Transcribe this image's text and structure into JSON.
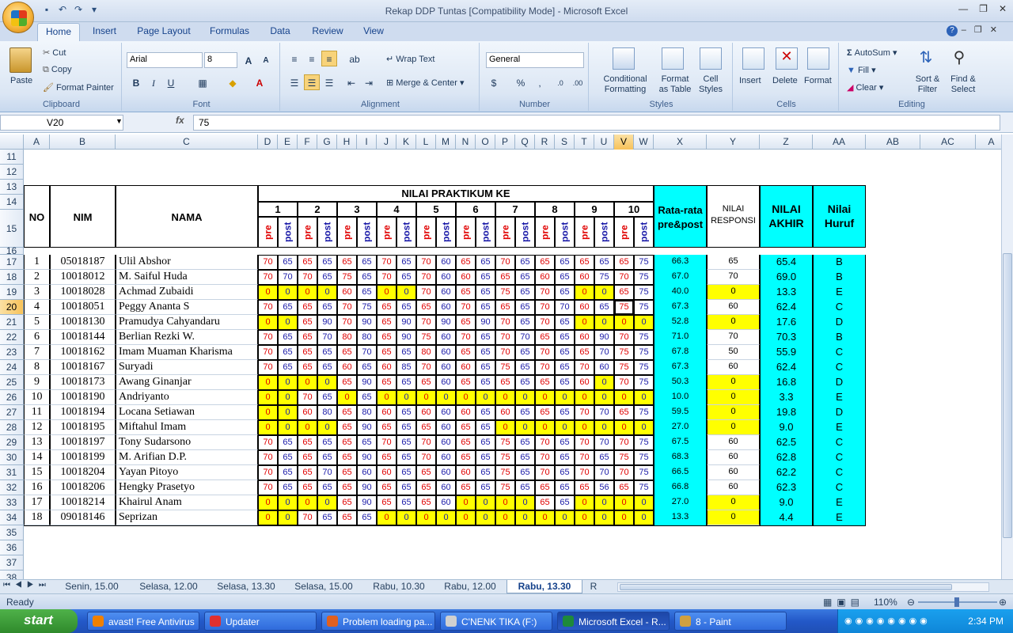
{
  "app": {
    "title": "Rekap DDP Tuntas  [Compatibility Mode] - Microsoft Excel"
  },
  "ribbon": {
    "tabs": [
      "Home",
      "Insert",
      "Page Layout",
      "Formulas",
      "Data",
      "Review",
      "View"
    ],
    "clipboard": {
      "paste": "Paste",
      "cut": "Cut",
      "copy": "Copy",
      "format_painter": "Format Painter",
      "label": "Clipboard"
    },
    "font": {
      "name": "Arial",
      "size": "8",
      "label": "Font"
    },
    "alignment": {
      "wrap": "Wrap Text",
      "merge": "Merge & Center",
      "label": "Alignment"
    },
    "number": {
      "format": "General",
      "label": "Number"
    },
    "styles": {
      "conditional": "Conditional Formatting",
      "format_table": "Format as Table",
      "cell_styles": "Cell Styles",
      "label": "Styles"
    },
    "cells": {
      "insert": "Insert",
      "delete": "Delete",
      "format": "Format",
      "label": "Cells"
    },
    "editing": {
      "autosum": "AutoSum",
      "fill": "Fill",
      "clear": "Clear",
      "sort": "Sort & Filter",
      "find": "Find & Select",
      "label": "Editing"
    }
  },
  "formula_bar": {
    "name_box": "V20",
    "fx": "fx",
    "value": "75"
  },
  "columns": [
    "A",
    "B",
    "C",
    "D",
    "E",
    "F",
    "G",
    "H",
    "I",
    "J",
    "K",
    "L",
    "M",
    "N",
    "O",
    "P",
    "Q",
    "R",
    "S",
    "T",
    "U",
    "V",
    "W",
    "X",
    "Y",
    "Z",
    "AA",
    "AB",
    "AC",
    "A"
  ],
  "header": {
    "no": "NO",
    "nim": "NIM",
    "nama": "NAMA",
    "praktikum": "NILAI PRAKTIKUM KE",
    "rata": "Rata-rata pre&post",
    "responsi": "NILAI RESPONSI",
    "akhir": "NILAI AKHIR",
    "huruf": "Nilai Huruf",
    "pre": "pre",
    "post": "post",
    "numbers": [
      "1",
      "2",
      "3",
      "4",
      "5",
      "6",
      "7",
      "8",
      "9",
      "10"
    ]
  },
  "students": [
    {
      "row": "17",
      "no": "1",
      "nim": "05018187",
      "nama": "Ulil Abshor",
      "scores": [
        "70",
        "65",
        "65",
        "65",
        "65",
        "65",
        "70",
        "65",
        "70",
        "60",
        "65",
        "65",
        "70",
        "65",
        "65",
        "65",
        "65",
        "65",
        "65",
        "75"
      ],
      "yel": 0,
      "rata": "66.3",
      "resp": "65",
      "akhir": "65.4",
      "huruf": "B"
    },
    {
      "row": "18",
      "no": "2",
      "nim": "10018012",
      "nama": "M. Saiful Huda",
      "scores": [
        "70",
        "70",
        "70",
        "65",
        "75",
        "65",
        "70",
        "65",
        "70",
        "60",
        "60",
        "65",
        "65",
        "65",
        "60",
        "65",
        "60",
        "75",
        "70",
        "75"
      ],
      "yel": 0,
      "rata": "67.0",
      "resp": "70",
      "akhir": "69.0",
      "huruf": "B"
    },
    {
      "row": "19",
      "no": "3",
      "nim": "10018028",
      "nama": "Achmad Zubaidi",
      "scores": [
        "0",
        "0",
        "0",
        "0",
        "60",
        "65",
        "0",
        "0",
        "70",
        "60",
        "65",
        "65",
        "75",
        "65",
        "70",
        "65",
        "0",
        "0",
        "65",
        "75"
      ],
      "yel": [
        0,
        1,
        2,
        3,
        6,
        7,
        16,
        17
      ],
      "rata": "40.0",
      "resp": "0",
      "akhir": "13.3",
      "huruf": "E"
    },
    {
      "row": "20",
      "no": "4",
      "nim": "10018051",
      "nama": "Peggy Ananta S",
      "scores": [
        "70",
        "65",
        "65",
        "65",
        "70",
        "75",
        "65",
        "65",
        "65",
        "60",
        "70",
        "65",
        "65",
        "65",
        "70",
        "70",
        "60",
        "65",
        "75",
        "75"
      ],
      "yel": 0,
      "rata": "67.3",
      "resp": "60",
      "akhir": "62.4",
      "huruf": "C"
    },
    {
      "row": "21",
      "no": "5",
      "nim": "10018130",
      "nama": "Pramudya Cahyandaru",
      "scores": [
        "0",
        "0",
        "65",
        "90",
        "70",
        "90",
        "65",
        "90",
        "70",
        "90",
        "65",
        "90",
        "70",
        "65",
        "70",
        "65",
        "0",
        "0",
        "0",
        "0"
      ],
      "yel": [
        0,
        1,
        16,
        17,
        18,
        19
      ],
      "rata": "52.8",
      "resp": "0",
      "akhir": "17.6",
      "huruf": "D"
    },
    {
      "row": "22",
      "no": "6",
      "nim": "10018144",
      "nama": "Berlian Rezki W.",
      "scores": [
        "70",
        "65",
        "65",
        "70",
        "80",
        "80",
        "65",
        "90",
        "75",
        "60",
        "70",
        "65",
        "70",
        "70",
        "65",
        "65",
        "60",
        "90",
        "70",
        "75"
      ],
      "yel": 0,
      "rata": "71.0",
      "resp": "70",
      "akhir": "70.3",
      "huruf": "B"
    },
    {
      "row": "23",
      "no": "7",
      "nim": "10018162",
      "nama": "Imam Muaman Kharisma",
      "scores": [
        "70",
        "65",
        "65",
        "65",
        "65",
        "70",
        "65",
        "65",
        "80",
        "60",
        "65",
        "65",
        "70",
        "65",
        "70",
        "65",
        "65",
        "70",
        "75",
        "75"
      ],
      "yel": 0,
      "rata": "67.8",
      "resp": "50",
      "akhir": "55.9",
      "huruf": "C"
    },
    {
      "row": "24",
      "no": "8",
      "nim": "10018167",
      "nama": "Suryadi",
      "scores": [
        "70",
        "65",
        "65",
        "65",
        "60",
        "65",
        "60",
        "85",
        "70",
        "60",
        "60",
        "65",
        "75",
        "65",
        "70",
        "65",
        "70",
        "60",
        "75",
        "75"
      ],
      "yel": 0,
      "rata": "67.3",
      "resp": "60",
      "akhir": "62.4",
      "huruf": "C"
    },
    {
      "row": "25",
      "no": "9",
      "nim": "10018173",
      "nama": "Awang Ginanjar",
      "scores": [
        "0",
        "0",
        "0",
        "0",
        "65",
        "90",
        "65",
        "65",
        "65",
        "60",
        "65",
        "65",
        "65",
        "65",
        "65",
        "65",
        "60",
        "0",
        "70",
        "75"
      ],
      "yel": [
        0,
        1,
        2,
        3,
        17
      ],
      "rata": "50.3",
      "resp": "0",
      "akhir": "16.8",
      "huruf": "D"
    },
    {
      "row": "26",
      "no": "10",
      "nim": "10018190",
      "nama": "Andriyanto",
      "scores": [
        "0",
        "0",
        "70",
        "65",
        "0",
        "65",
        "0",
        "0",
        "0",
        "0",
        "0",
        "0",
        "0",
        "0",
        "0",
        "0",
        "0",
        "0",
        "0",
        "0"
      ],
      "yel": [
        0,
        1,
        4,
        6,
        7,
        8,
        9,
        10,
        11,
        12,
        13,
        14,
        15,
        16,
        17,
        18,
        19
      ],
      "rata": "10.0",
      "resp": "0",
      "akhir": "3.3",
      "huruf": "E"
    },
    {
      "row": "27",
      "no": "11",
      "nim": "10018194",
      "nama": "Locana Setiawan",
      "scores": [
        "0",
        "0",
        "60",
        "80",
        "65",
        "80",
        "60",
        "65",
        "60",
        "60",
        "60",
        "65",
        "60",
        "65",
        "65",
        "65",
        "70",
        "70",
        "65",
        "75"
      ],
      "yel": [
        0,
        1
      ],
      "rata": "59.5",
      "resp": "0",
      "akhir": "19.8",
      "huruf": "D"
    },
    {
      "row": "28",
      "no": "12",
      "nim": "10018195",
      "nama": "Miftahul Imam",
      "scores": [
        "0",
        "0",
        "0",
        "0",
        "65",
        "90",
        "65",
        "65",
        "65",
        "60",
        "65",
        "65",
        "0",
        "0",
        "0",
        "0",
        "0",
        "0",
        "0",
        "0"
      ],
      "yel": [
        0,
        1,
        2,
        3,
        12,
        13,
        14,
        15,
        16,
        17,
        18,
        19
      ],
      "rata": "27.0",
      "resp": "0",
      "akhir": "9.0",
      "huruf": "E"
    },
    {
      "row": "29",
      "no": "13",
      "nim": "10018197",
      "nama": "Tony Sudarsono",
      "scores": [
        "70",
        "65",
        "65",
        "65",
        "65",
        "65",
        "70",
        "65",
        "70",
        "60",
        "65",
        "65",
        "75",
        "65",
        "70",
        "65",
        "70",
        "70",
        "70",
        "75"
      ],
      "yel": 0,
      "rata": "67.5",
      "resp": "60",
      "akhir": "62.5",
      "huruf": "C"
    },
    {
      "row": "30",
      "no": "14",
      "nim": "10018199",
      "nama": "M. Arifian D.P.",
      "scores": [
        "70",
        "65",
        "65",
        "65",
        "65",
        "90",
        "65",
        "65",
        "70",
        "60",
        "65",
        "65",
        "75",
        "65",
        "70",
        "65",
        "70",
        "65",
        "75",
        "75"
      ],
      "yel": 0,
      "rata": "68.3",
      "resp": "60",
      "akhir": "62.8",
      "huruf": "C"
    },
    {
      "row": "31",
      "no": "15",
      "nim": "10018204",
      "nama": "Yayan Pitoyo",
      "scores": [
        "70",
        "65",
        "65",
        "70",
        "65",
        "60",
        "60",
        "65",
        "65",
        "60",
        "60",
        "65",
        "75",
        "65",
        "70",
        "65",
        "70",
        "70",
        "70",
        "75"
      ],
      "yel": 0,
      "rata": "66.5",
      "resp": "60",
      "akhir": "62.2",
      "huruf": "C"
    },
    {
      "row": "32",
      "no": "16",
      "nim": "10018206",
      "nama": "Hengky Prasetyo",
      "scores": [
        "70",
        "65",
        "65",
        "65",
        "65",
        "90",
        "65",
        "65",
        "65",
        "60",
        "65",
        "65",
        "75",
        "65",
        "65",
        "65",
        "65",
        "56",
        "65",
        "75"
      ],
      "yel": 0,
      "rata": "66.8",
      "resp": "60",
      "akhir": "62.3",
      "huruf": "C"
    },
    {
      "row": "33",
      "no": "17",
      "nim": "10018214",
      "nama": "Khairul Anam",
      "scores": [
        "0",
        "0",
        "0",
        "0",
        "65",
        "90",
        "65",
        "65",
        "65",
        "60",
        "0",
        "0",
        "0",
        "0",
        "65",
        "65",
        "0",
        "0",
        "0",
        "0"
      ],
      "yel": [
        0,
        1,
        2,
        3,
        10,
        11,
        12,
        13,
        16,
        17,
        18,
        19
      ],
      "rata": "27.0",
      "resp": "0",
      "akhir": "9.0",
      "huruf": "E"
    },
    {
      "row": "34",
      "no": "18",
      "nim": "09018146",
      "nama": "Seprizan",
      "scores": [
        "0",
        "0",
        "70",
        "65",
        "65",
        "65",
        "0",
        "0",
        "0",
        "0",
        "0",
        "0",
        "0",
        "0",
        "0",
        "0",
        "0",
        "0",
        "0",
        "0"
      ],
      "yel": [
        0,
        1,
        6,
        7,
        8,
        9,
        10,
        11,
        12,
        13,
        14,
        15,
        16,
        17,
        18,
        19
      ],
      "rata": "13.3",
      "resp": "0",
      "akhir": "4.4",
      "huruf": "E"
    }
  ],
  "empty_rows": [
    "11",
    "12",
    "35",
    "36",
    "37",
    "38"
  ],
  "sheet_tabs": [
    "Senin, 15.00",
    "Selasa, 12.00",
    "Selasa, 13.30",
    "Selasa, 15.00",
    "Rabu, 10.30",
    "Rabu, 12.00",
    "Rabu, 13.30",
    "R"
  ],
  "active_sheet": "Rabu, 13.30",
  "status": {
    "ready": "Ready",
    "zoom": "110%"
  },
  "taskbar": {
    "start": "start",
    "tasks": [
      "avast! Free Antivirus",
      "Updater",
      "Problem loading pa...",
      "C'NENK TIKA (F:)",
      "Microsoft Excel - R...",
      "8 - Paint"
    ],
    "clock": "2:34 PM"
  },
  "colors": {
    "yellow": "#ffff00",
    "cyan": "#00ffff",
    "pre": "#e00000",
    "post": "#1a1aa8"
  }
}
